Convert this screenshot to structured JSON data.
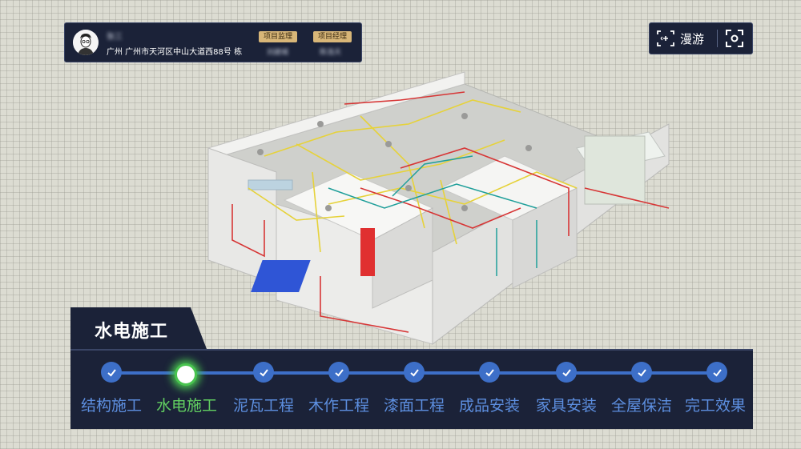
{
  "user_card": {
    "name": "张三",
    "address": "广州 广州市天河区中山大道西88号 栋",
    "roles": [
      {
        "label": "项目监理",
        "person": "刘建城"
      },
      {
        "label": "项目经理",
        "person": "陈浩天"
      }
    ]
  },
  "toolbar": {
    "roam_label": "漫游",
    "roam_icon": "roam-icon",
    "focus_icon": "focus-target-icon"
  },
  "current_stage": {
    "title": "水电施工"
  },
  "timeline": {
    "steps": [
      {
        "label": "结构施工",
        "status": "done"
      },
      {
        "label": "水电施工",
        "status": "current"
      },
      {
        "label": "泥瓦工程",
        "status": "done"
      },
      {
        "label": "木作工程",
        "status": "done"
      },
      {
        "label": "漆面工程",
        "status": "done"
      },
      {
        "label": "成品安装",
        "status": "done"
      },
      {
        "label": "家具安装",
        "status": "done"
      },
      {
        "label": "全屋保洁",
        "status": "done"
      },
      {
        "label": "完工效果",
        "status": "done"
      }
    ]
  },
  "colors": {
    "panel_bg": "#1b2238",
    "accent_blue": "#3d6fc8",
    "active_green": "#49c34f",
    "badge_gold": "#d8b678"
  }
}
